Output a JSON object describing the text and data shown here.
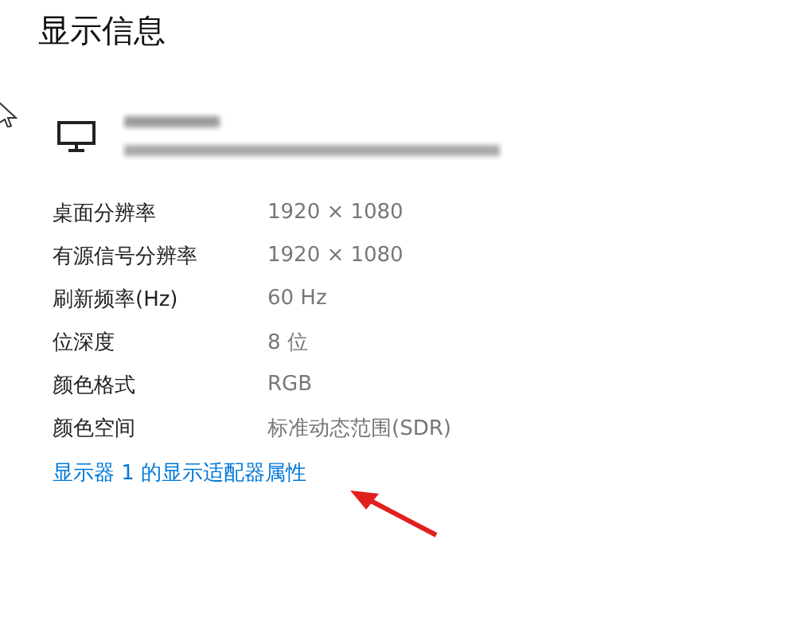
{
  "title": "显示信息",
  "details": [
    {
      "label": "桌面分辨率",
      "value": "1920 × 1080"
    },
    {
      "label": "有源信号分辨率",
      "value": "1920 × 1080"
    },
    {
      "label": "刷新频率(Hz)",
      "value": "60 Hz"
    },
    {
      "label": "位深度",
      "value": "8 位"
    },
    {
      "label": "颜色格式",
      "value": "RGB"
    },
    {
      "label": "颜色空间",
      "value": "标准动态范围(SDR)"
    }
  ],
  "link": "显示器 1 的显示适配器属性"
}
